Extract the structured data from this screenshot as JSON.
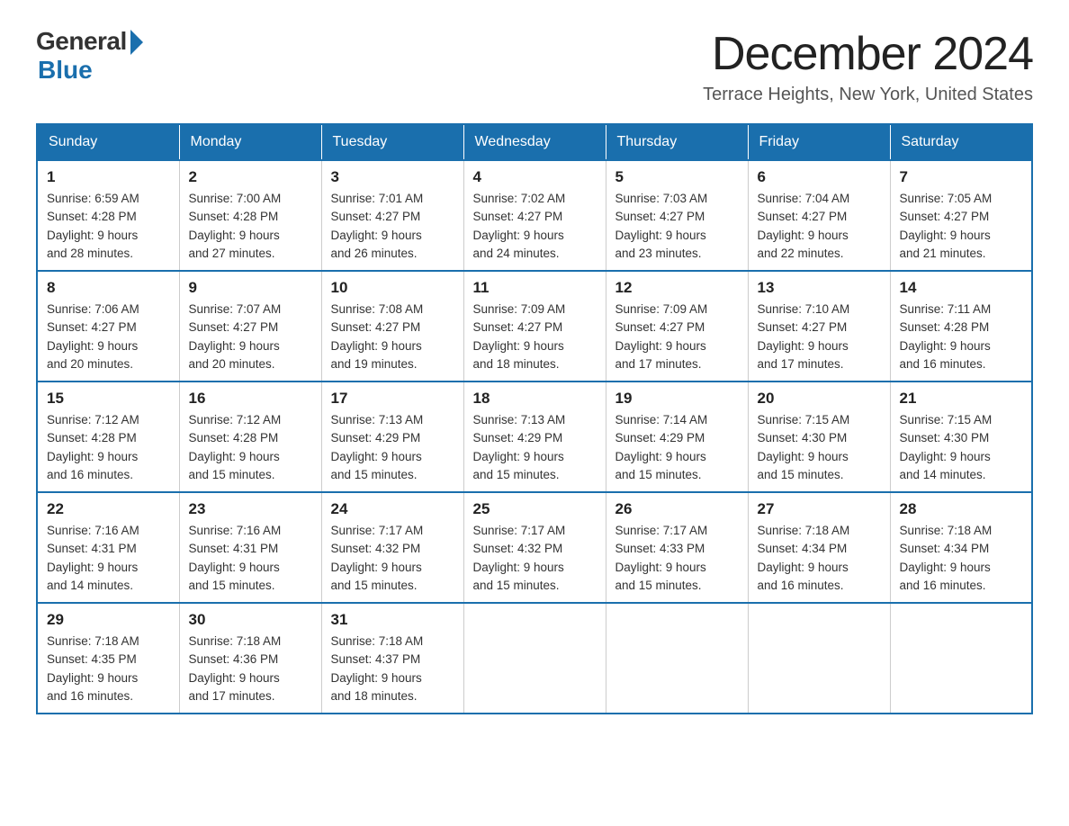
{
  "logo": {
    "general": "General",
    "blue": "Blue"
  },
  "title": "December 2024",
  "location": "Terrace Heights, New York, United States",
  "weekdays": [
    "Sunday",
    "Monday",
    "Tuesday",
    "Wednesday",
    "Thursday",
    "Friday",
    "Saturday"
  ],
  "weeks": [
    [
      {
        "day": "1",
        "sunrise": "6:59 AM",
        "sunset": "4:28 PM",
        "daylight": "9 hours and 28 minutes."
      },
      {
        "day": "2",
        "sunrise": "7:00 AM",
        "sunset": "4:28 PM",
        "daylight": "9 hours and 27 minutes."
      },
      {
        "day": "3",
        "sunrise": "7:01 AM",
        "sunset": "4:27 PM",
        "daylight": "9 hours and 26 minutes."
      },
      {
        "day": "4",
        "sunrise": "7:02 AM",
        "sunset": "4:27 PM",
        "daylight": "9 hours and 24 minutes."
      },
      {
        "day": "5",
        "sunrise": "7:03 AM",
        "sunset": "4:27 PM",
        "daylight": "9 hours and 23 minutes."
      },
      {
        "day": "6",
        "sunrise": "7:04 AM",
        "sunset": "4:27 PM",
        "daylight": "9 hours and 22 minutes."
      },
      {
        "day": "7",
        "sunrise": "7:05 AM",
        "sunset": "4:27 PM",
        "daylight": "9 hours and 21 minutes."
      }
    ],
    [
      {
        "day": "8",
        "sunrise": "7:06 AM",
        "sunset": "4:27 PM",
        "daylight": "9 hours and 20 minutes."
      },
      {
        "day": "9",
        "sunrise": "7:07 AM",
        "sunset": "4:27 PM",
        "daylight": "9 hours and 20 minutes."
      },
      {
        "day": "10",
        "sunrise": "7:08 AM",
        "sunset": "4:27 PM",
        "daylight": "9 hours and 19 minutes."
      },
      {
        "day": "11",
        "sunrise": "7:09 AM",
        "sunset": "4:27 PM",
        "daylight": "9 hours and 18 minutes."
      },
      {
        "day": "12",
        "sunrise": "7:09 AM",
        "sunset": "4:27 PM",
        "daylight": "9 hours and 17 minutes."
      },
      {
        "day": "13",
        "sunrise": "7:10 AM",
        "sunset": "4:27 PM",
        "daylight": "9 hours and 17 minutes."
      },
      {
        "day": "14",
        "sunrise": "7:11 AM",
        "sunset": "4:28 PM",
        "daylight": "9 hours and 16 minutes."
      }
    ],
    [
      {
        "day": "15",
        "sunrise": "7:12 AM",
        "sunset": "4:28 PM",
        "daylight": "9 hours and 16 minutes."
      },
      {
        "day": "16",
        "sunrise": "7:12 AM",
        "sunset": "4:28 PM",
        "daylight": "9 hours and 15 minutes."
      },
      {
        "day": "17",
        "sunrise": "7:13 AM",
        "sunset": "4:29 PM",
        "daylight": "9 hours and 15 minutes."
      },
      {
        "day": "18",
        "sunrise": "7:13 AM",
        "sunset": "4:29 PM",
        "daylight": "9 hours and 15 minutes."
      },
      {
        "day": "19",
        "sunrise": "7:14 AM",
        "sunset": "4:29 PM",
        "daylight": "9 hours and 15 minutes."
      },
      {
        "day": "20",
        "sunrise": "7:15 AM",
        "sunset": "4:30 PM",
        "daylight": "9 hours and 15 minutes."
      },
      {
        "day": "21",
        "sunrise": "7:15 AM",
        "sunset": "4:30 PM",
        "daylight": "9 hours and 14 minutes."
      }
    ],
    [
      {
        "day": "22",
        "sunrise": "7:16 AM",
        "sunset": "4:31 PM",
        "daylight": "9 hours and 14 minutes."
      },
      {
        "day": "23",
        "sunrise": "7:16 AM",
        "sunset": "4:31 PM",
        "daylight": "9 hours and 15 minutes."
      },
      {
        "day": "24",
        "sunrise": "7:17 AM",
        "sunset": "4:32 PM",
        "daylight": "9 hours and 15 minutes."
      },
      {
        "day": "25",
        "sunrise": "7:17 AM",
        "sunset": "4:32 PM",
        "daylight": "9 hours and 15 minutes."
      },
      {
        "day": "26",
        "sunrise": "7:17 AM",
        "sunset": "4:33 PM",
        "daylight": "9 hours and 15 minutes."
      },
      {
        "day": "27",
        "sunrise": "7:18 AM",
        "sunset": "4:34 PM",
        "daylight": "9 hours and 16 minutes."
      },
      {
        "day": "28",
        "sunrise": "7:18 AM",
        "sunset": "4:34 PM",
        "daylight": "9 hours and 16 minutes."
      }
    ],
    [
      {
        "day": "29",
        "sunrise": "7:18 AM",
        "sunset": "4:35 PM",
        "daylight": "9 hours and 16 minutes."
      },
      {
        "day": "30",
        "sunrise": "7:18 AM",
        "sunset": "4:36 PM",
        "daylight": "9 hours and 17 minutes."
      },
      {
        "day": "31",
        "sunrise": "7:18 AM",
        "sunset": "4:37 PM",
        "daylight": "9 hours and 18 minutes."
      },
      null,
      null,
      null,
      null
    ]
  ],
  "labels": {
    "sunrise": "Sunrise:",
    "sunset": "Sunset:",
    "daylight": "Daylight:"
  }
}
